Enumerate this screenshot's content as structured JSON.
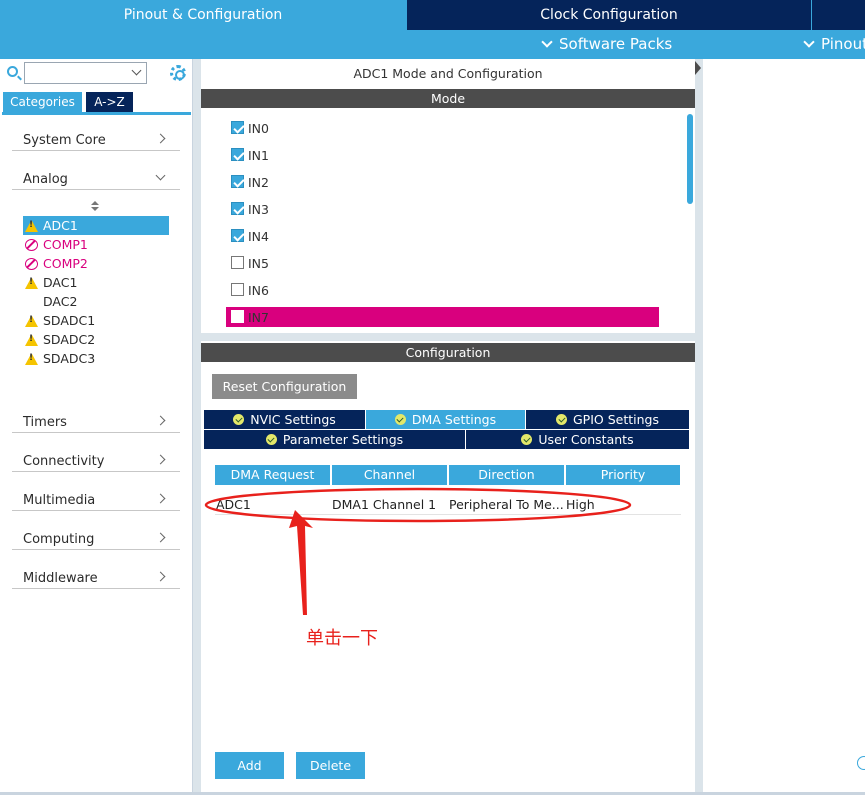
{
  "top_tabs": {
    "pinout": "Pinout & Configuration",
    "clock": "Clock Configuration"
  },
  "sub_bar": {
    "software_packs": "Software Packs",
    "pinout": "Pinout"
  },
  "left": {
    "tabs": {
      "categories": "Categories",
      "az": "A->Z"
    },
    "categories": {
      "system_core": "System Core",
      "analog": "Analog",
      "timers": "Timers",
      "connectivity": "Connectivity",
      "multimedia": "Multimedia",
      "computing": "Computing",
      "middleware": "Middleware"
    },
    "analog_items": [
      {
        "label": "ADC1",
        "icon": "warning-icon",
        "status": "selected"
      },
      {
        "label": "COMP1",
        "icon": "ban-icon",
        "status": "disabled"
      },
      {
        "label": "COMP2",
        "icon": "ban-icon",
        "status": "disabled"
      },
      {
        "label": "DAC1",
        "icon": "warning-icon",
        "status": "warning"
      },
      {
        "label": "DAC2",
        "icon": "",
        "status": "normal"
      },
      {
        "label": "SDADC1",
        "icon": "warning-icon",
        "status": "warning"
      },
      {
        "label": "SDADC2",
        "icon": "warning-icon",
        "status": "warning"
      },
      {
        "label": "SDADC3",
        "icon": "warning-icon",
        "status": "warning"
      }
    ]
  },
  "mode": {
    "title": "ADC1 Mode and Configuration",
    "header": "Mode",
    "inputs": [
      {
        "label": "IN0",
        "checked": true
      },
      {
        "label": "IN1",
        "checked": true
      },
      {
        "label": "IN2",
        "checked": true
      },
      {
        "label": "IN3",
        "checked": true
      },
      {
        "label": "IN4",
        "checked": true
      },
      {
        "label": "IN5",
        "checked": false
      },
      {
        "label": "IN6",
        "checked": false
      },
      {
        "label": "IN7",
        "checked": false
      }
    ]
  },
  "config": {
    "header": "Configuration",
    "reset_label": "Reset Configuration",
    "tabs": {
      "nvic": "NVIC Settings",
      "dma": "DMA Settings",
      "gpio": "GPIO Settings",
      "parameter": "Parameter Settings",
      "user_constants": "User Constants"
    },
    "table": {
      "headers": [
        "DMA Request",
        "Channel",
        "Direction",
        "Priority"
      ],
      "rows": [
        [
          "ADC1",
          "DMA1 Channel 1",
          "Peripheral To Me...",
          "High"
        ]
      ]
    },
    "add_label": "Add",
    "delete_label": "Delete"
  },
  "annotation": {
    "text": "单击一下"
  },
  "colors": {
    "accent": "#3aa8dc",
    "dark_navy": "#05245a",
    "header_gray": "#4c4c4c",
    "magenta": "#d9007e",
    "annotation_red": "#e8211c"
  }
}
